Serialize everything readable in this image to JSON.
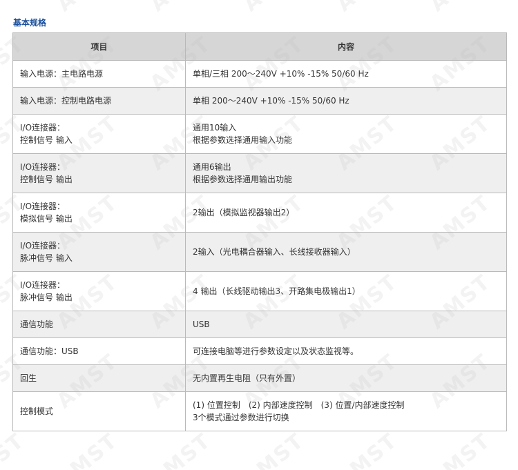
{
  "section_title": "基本规格",
  "table": {
    "headers": [
      "项目",
      "内容"
    ],
    "rows": [
      {
        "item": [
          "输入电源：主电路电源"
        ],
        "content": [
          "单相/三相 200～240V +10% -15% 50/60 Hz"
        ],
        "height": 39
      },
      {
        "item": [
          "输入电源：控制电路电源"
        ],
        "content": [
          "单相 200～240V +10% -15% 50/60 Hz"
        ],
        "height": 39
      },
      {
        "item": [
          "I/O连接器：",
          "控制信号 输入"
        ],
        "content": [
          "通用10输入",
          "根据参数选择通用输入功能"
        ],
        "height": 57
      },
      {
        "item": [
          "I/O连接器：",
          "控制信号 输出"
        ],
        "content": [
          "通用6输出",
          "根据参数选择通用输出功能"
        ],
        "height": 57
      },
      {
        "item": [
          "I/O连接器：",
          "模拟信号 输出"
        ],
        "content": [
          "2输出（模拟监视器输出2）"
        ],
        "height": 57
      },
      {
        "item": [
          "I/O连接器：",
          "脉冲信号 输入"
        ],
        "content": [
          "2输入（光电耦合器输入、长线接收器输入）"
        ],
        "height": 57
      },
      {
        "item": [
          "I/O连接器：",
          "脉冲信号 输出"
        ],
        "content": [
          "4 输出（长线驱动输出3、开路集电极输出1）"
        ],
        "height": 57
      },
      {
        "item": [
          "通信功能"
        ],
        "content": [
          "USB"
        ],
        "height": 39
      },
      {
        "item": [
          "通信功能：USB"
        ],
        "content": [
          "可连接电脑等进行参数设定以及状态监视等。"
        ],
        "height": 39
      },
      {
        "item": [
          "回生"
        ],
        "content": [
          "无内置再生电阻（只有外置）"
        ],
        "height": 39
      },
      {
        "item": [
          "控制模式"
        ],
        "content": [
          "(1) 位置控制　(2) 内部速度控制　(3) 位置/内部速度控制",
          "3个模式通过参数进行切换"
        ],
        "height": 57
      }
    ]
  },
  "watermark_text": "AMST"
}
